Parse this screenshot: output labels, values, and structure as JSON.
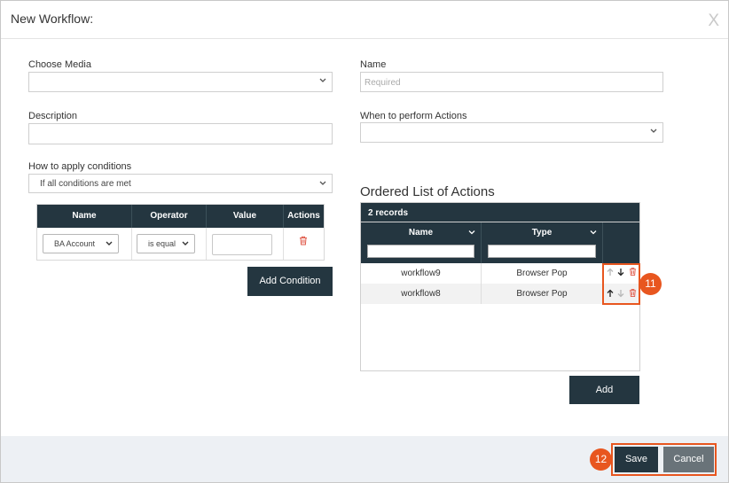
{
  "dialog": {
    "title": "New Workflow:",
    "close_label": "X"
  },
  "form": {
    "choose_media": {
      "label": "Choose Media",
      "value": ""
    },
    "name": {
      "label": "Name",
      "placeholder": "Required"
    },
    "description": {
      "label": "Description",
      "value": ""
    },
    "when_to_perform": {
      "label": "When to perform Actions",
      "value": ""
    },
    "how_to_apply": {
      "label": "How to apply conditions",
      "value": "If all conditions are met"
    }
  },
  "conditions": {
    "columns": [
      "Name",
      "Operator",
      "Value",
      "Actions"
    ],
    "row": {
      "name": "BA Account",
      "operator": "is equal",
      "value": ""
    },
    "add_label": "Add Condition"
  },
  "actions": {
    "title": "Ordered List of Actions",
    "records": "2 records",
    "columns": [
      "Name",
      "Type"
    ],
    "rows": [
      {
        "name": "workflow9",
        "type": "Browser Pop"
      },
      {
        "name": "workflow8",
        "type": "Browser Pop"
      }
    ],
    "add_label": "Add"
  },
  "callouts": {
    "reorder": "11",
    "save": "12"
  },
  "footer": {
    "save_label": "Save",
    "cancel_label": "Cancel"
  },
  "colors": {
    "header_dark": "#243640",
    "highlight": "#e8561f",
    "delete_red": "#e05a4a"
  }
}
